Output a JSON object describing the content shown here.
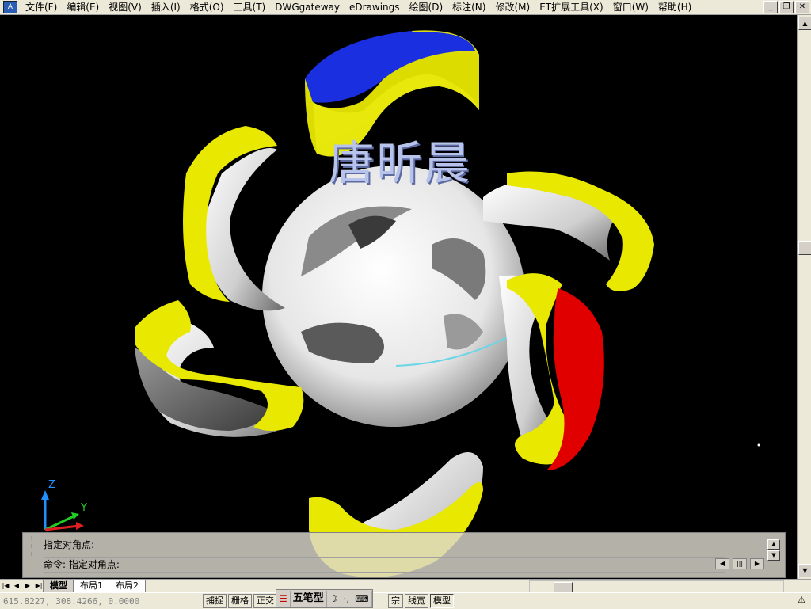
{
  "menubar": {
    "items": [
      {
        "label": "文件(F)"
      },
      {
        "label": "编辑(E)"
      },
      {
        "label": "视图(V)"
      },
      {
        "label": "插入(I)"
      },
      {
        "label": "格式(O)"
      },
      {
        "label": "工具(T)"
      },
      {
        "label": "DWGgateway"
      },
      {
        "label": "eDrawings"
      },
      {
        "label": "绘图(D)"
      },
      {
        "label": "标注(N)"
      },
      {
        "label": "修改(M)"
      },
      {
        "label": "ET扩展工具(X)"
      },
      {
        "label": "窗口(W)"
      },
      {
        "label": "帮助(H)"
      }
    ]
  },
  "canvas": {
    "watermark": "唐昕晨",
    "background": "#000000",
    "colors": {
      "yellow": "#e8e800",
      "blue": "#1a2fe0",
      "red": "#e00000",
      "white": "#f2f2f2",
      "axis_cyan": "#6ad6e6"
    },
    "ucs": {
      "x_label": "X",
      "y_label": "Y",
      "z_label": "Z"
    }
  },
  "command": {
    "line1": "指定对角点:",
    "line2": "命令: 指定对角点:"
  },
  "tabs": {
    "items": [
      {
        "label": "模型",
        "active": true
      },
      {
        "label": "布局1",
        "active": false
      },
      {
        "label": "布局2",
        "active": false
      }
    ]
  },
  "status": {
    "coords": "615.8227, 308.4266, 0.0000",
    "toggles": [
      "捕捉",
      "栅格",
      "正交"
    ],
    "toggles_right": [
      "宗",
      "线宽",
      "模型"
    ],
    "ime_name": "五笔型"
  }
}
